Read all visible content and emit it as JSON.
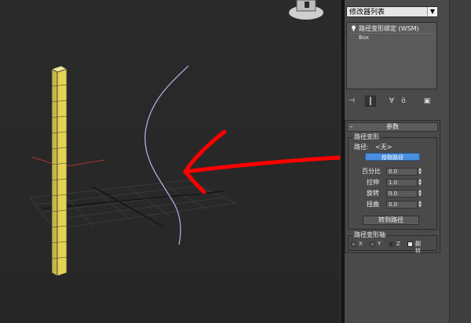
{
  "modifier_panel": {
    "modifier_list": "修改器列表",
    "dropdown_arrow": "▼",
    "stack": [
      {
        "label": "路径变形绑定 (WSM)"
      },
      {
        "label": "Box"
      }
    ]
  },
  "toolbar": {
    "icons": [
      "pin-stack-icon",
      "show-end-result-icon",
      "make-unique-icon",
      "remove-modifier-icon",
      "configure-sets-icon"
    ]
  },
  "parameters": {
    "header": "参数",
    "collapse": "-",
    "path_deform": {
      "title": "路径变形",
      "path_label": "路径:",
      "path_value": "<无>",
      "pick_path": "拾取路径",
      "percent_label": "百分比",
      "percent_value": "0.0",
      "stretch_label": "拉伸",
      "stretch_value": "1.0",
      "rotation_label": "旋转",
      "rotation_value": "0.0",
      "twist_label": "扭曲",
      "twist_value": "0.0",
      "move_to_path": "转到路径"
    },
    "axis": {
      "title": "路径变形轴",
      "x": "X",
      "y": "Y",
      "z": "Z",
      "selected": "Z",
      "flip": "翻转"
    }
  },
  "colors": {
    "accent": "#4a8ede",
    "box_yellow": "#d8c94a",
    "annotation_red": "#ff0000",
    "path_curve": "#b9b4ea"
  }
}
